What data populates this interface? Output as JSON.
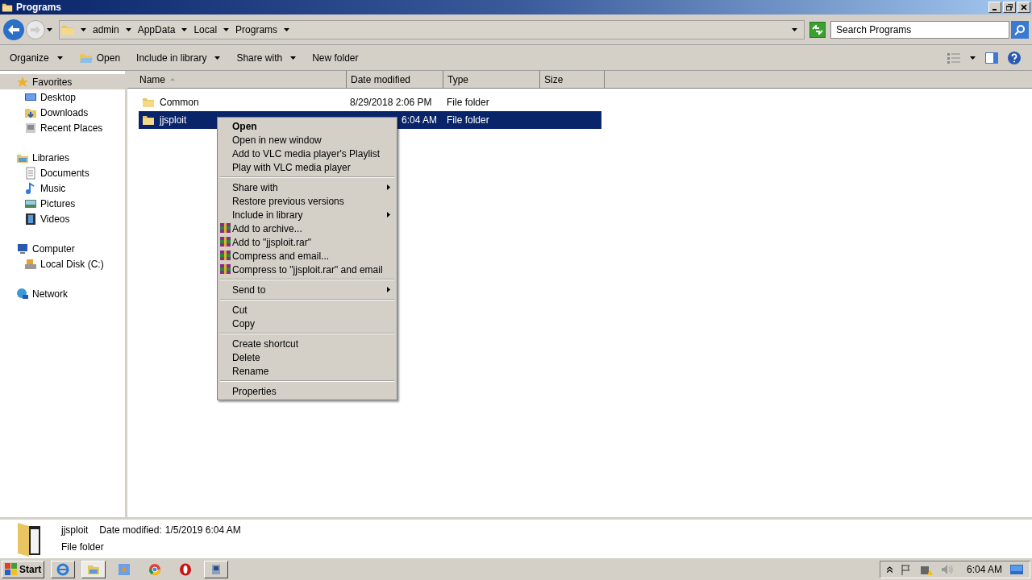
{
  "window": {
    "title": "Programs"
  },
  "breadcrumb": [
    "admin",
    "AppData",
    "Local",
    "Programs"
  ],
  "search": {
    "placeholder": "Search Programs"
  },
  "toolbar": [
    {
      "label": "Organize",
      "dropdown": true
    },
    {
      "label": "Open",
      "dropdown": false
    },
    {
      "label": "Include in library",
      "dropdown": true
    },
    {
      "label": "Share with",
      "dropdown": true
    },
    {
      "label": "New folder",
      "dropdown": false
    }
  ],
  "sidebar": [
    {
      "label": "Favorites",
      "selected": true,
      "children": [
        {
          "label": "Desktop",
          "selected": false
        },
        {
          "label": "Downloads",
          "selected": false
        },
        {
          "label": "Recent Places",
          "selected": false
        }
      ]
    },
    {
      "label": "Libraries",
      "selected": false,
      "children": [
        {
          "label": "Documents",
          "selected": false
        },
        {
          "label": "Music",
          "selected": false
        },
        {
          "label": "Pictures",
          "selected": false
        },
        {
          "label": "Videos",
          "selected": false
        }
      ]
    },
    {
      "label": "Computer",
      "selected": false,
      "children": [
        {
          "label": "Local Disk (C:)",
          "selected": false
        }
      ]
    },
    {
      "label": "Network",
      "selected": false
    }
  ],
  "table": {
    "columns": [
      "Name",
      "Date modified",
      "Type",
      "Size"
    ],
    "rows": [
      {
        "name": "Common",
        "date": "8/29/2018 2:06 PM",
        "type": "File folder",
        "selected": false
      },
      {
        "name": "jjsploit",
        "date": "6:04 AM",
        "type": "File folder",
        "selected": true
      }
    ]
  },
  "context_menu": [
    {
      "kind": "item",
      "label": "Open",
      "bold": true,
      "submenu": false,
      "archive_icon": false
    },
    {
      "kind": "item",
      "label": "Open in new window",
      "bold": false,
      "submenu": false,
      "archive_icon": false
    },
    {
      "kind": "item",
      "label": "Add to VLC media player's Playlist",
      "bold": false,
      "submenu": false,
      "archive_icon": false
    },
    {
      "kind": "item",
      "label": "Play with VLC media player",
      "bold": false,
      "submenu": false,
      "archive_icon": false
    },
    {
      "kind": "separator"
    },
    {
      "kind": "item",
      "label": "Share with",
      "bold": false,
      "submenu": true,
      "archive_icon": false
    },
    {
      "kind": "item",
      "label": "Restore previous versions",
      "bold": false,
      "submenu": false,
      "archive_icon": false
    },
    {
      "kind": "item",
      "label": "Include in library",
      "bold": false,
      "submenu": true,
      "archive_icon": false
    },
    {
      "kind": "item",
      "label": "Add to archive...",
      "bold": false,
      "submenu": false,
      "archive_icon": true
    },
    {
      "kind": "item",
      "label": "Add to \"jjsploit.rar\"",
      "bold": false,
      "submenu": false,
      "archive_icon": true
    },
    {
      "kind": "item",
      "label": "Compress and email...",
      "bold": false,
      "submenu": false,
      "archive_icon": true
    },
    {
      "kind": "item",
      "label": "Compress to \"jjsploit.rar\" and email",
      "bold": false,
      "submenu": false,
      "archive_icon": true
    },
    {
      "kind": "separator"
    },
    {
      "kind": "item",
      "label": "Send to",
      "bold": false,
      "submenu": true,
      "archive_icon": false
    },
    {
      "kind": "separator"
    },
    {
      "kind": "item",
      "label": "Cut",
      "bold": false,
      "submenu": false,
      "archive_icon": false
    },
    {
      "kind": "item",
      "label": "Copy",
      "bold": false,
      "submenu": false,
      "archive_icon": false
    },
    {
      "kind": "separator"
    },
    {
      "kind": "item",
      "label": "Create shortcut",
      "bold": false,
      "submenu": false,
      "archive_icon": false
    },
    {
      "kind": "item",
      "label": "Delete",
      "bold": false,
      "submenu": false,
      "archive_icon": false
    },
    {
      "kind": "item",
      "label": "Rename",
      "bold": false,
      "submenu": false,
      "archive_icon": false
    },
    {
      "kind": "separator"
    },
    {
      "kind": "item",
      "label": "Properties",
      "bold": false,
      "submenu": false,
      "archive_icon": false
    }
  ],
  "details": {
    "name": "jjsploit",
    "date_label": "Date modified:",
    "date": "1/5/2019 6:04 AM",
    "type": "File folder"
  },
  "taskbar": {
    "start": "Start",
    "clock": "6:04 AM"
  }
}
